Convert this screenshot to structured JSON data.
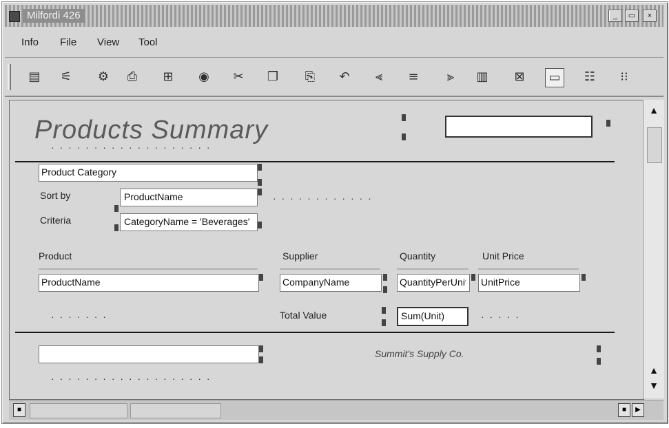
{
  "window": {
    "title": "Milfordi 426",
    "buttons": {
      "minimize": "_",
      "maximize": "▭",
      "close": "×"
    }
  },
  "menubar": {
    "items": [
      "Info",
      "File",
      "View",
      "Tool"
    ]
  },
  "toolbar": {
    "icons": [
      "report-icon",
      "wizard-icon",
      "settings-icon",
      "preview-icon",
      "grid-icon",
      "stop-icon",
      "cut-icon",
      "copy-icon",
      "paste-icon",
      "undo-icon",
      "align-left-icon",
      "align-center-icon",
      "align-right-icon",
      "bold-icon",
      "table-icon",
      "chart-icon",
      "list-icon",
      "fields-icon"
    ]
  },
  "design": {
    "title": "Products Summary",
    "header_field": "",
    "group_label": "Product Category",
    "filter_labels": [
      "Sort by",
      "Criteria"
    ],
    "filter_values": [
      "ProductName",
      "CategoryName = 'Beverages'"
    ],
    "columns": [
      "Product",
      "Supplier",
      "Quantity",
      "Unit Price"
    ],
    "column_fields": [
      "ProductName",
      "CompanyName",
      "QuantityPerUnit",
      "UnitPrice"
    ],
    "total_label": "Total Value",
    "total_field": "Sum(Unit)",
    "footer_field": "",
    "footer_text": "Summit's Supply Co."
  }
}
